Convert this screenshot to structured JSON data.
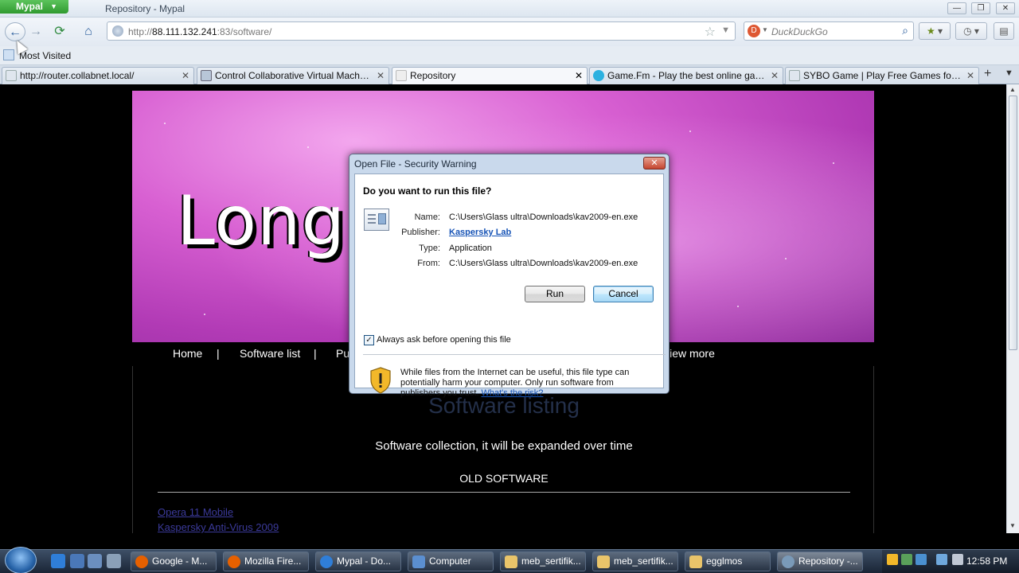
{
  "window": {
    "app_button": "Mypal",
    "title": "Repository - Mypal",
    "minimize_glyph": "—",
    "restore_glyph": "❐",
    "close_glyph": "✕"
  },
  "nav": {
    "back_icon": "arrow-left",
    "forward_icon": "arrow-right",
    "reload_icon": "reload",
    "home_icon": "home",
    "url_prefix": "http://",
    "url_host": "88.111.132.241",
    "url_rest": ":83/software/",
    "search_placeholder": "DuckDuckGo",
    "search_engine_icon": "duckduckgo"
  },
  "bookmarks": {
    "most_visited": "Most Visited"
  },
  "tabs": [
    {
      "label": "http://router.collabnet.local/",
      "active": false
    },
    {
      "label": "Control Collaborative Virtual Machin...",
      "active": false
    },
    {
      "label": "Repository",
      "active": true
    },
    {
      "label": "Game.Fm - Play the best online gam...",
      "active": false
    },
    {
      "label": "SYBO Game | Play Free Games for m...",
      "active": false
    }
  ],
  "tab_new": "+",
  "page": {
    "banner_text": "Longh                  s Repo",
    "menu": {
      "home": "Home",
      "sep1": "|",
      "software_list": "Software list",
      "sep2": "|",
      "partial": "Pu",
      "view_more": "View more"
    },
    "heading": "Software listing",
    "subtitle": "Software collection, it will be expanded over time",
    "section": "OLD SOFTWARE",
    "links": [
      "Opera 11 Mobile",
      "Kaspersky Anti-Virus 2009"
    ]
  },
  "dialog": {
    "title": "Open File - Security Warning",
    "question": "Do you want to run this file?",
    "labels": {
      "name": "Name:",
      "publisher": "Publisher:",
      "type": "Type:",
      "from": "From:"
    },
    "values": {
      "name": "C:\\Users\\Glass ultra\\Downloads\\kav2009-en.exe",
      "publisher": "Kaspersky Lab",
      "type": "Application",
      "from": "C:\\Users\\Glass ultra\\Downloads\\kav2009-en.exe"
    },
    "run_button": "Run",
    "cancel_button": "Cancel",
    "checkbox_label": "Always ask before opening this file",
    "checkbox_checked": true,
    "warning_text": "While files from the Internet can be useful, this file type can potentially harm your computer. Only run software from publishers you trust.",
    "risk_link": "What's the risk?"
  },
  "taskbar": {
    "items": [
      {
        "label": "Google - M...",
        "icon": "firefox-icon",
        "color": "#e66000"
      },
      {
        "label": "Mozilla Fire...",
        "icon": "firefox-icon",
        "color": "#e66000"
      },
      {
        "label": "Mypal - Do...",
        "icon": "ie-icon",
        "color": "#2f7ed8"
      },
      {
        "label": "Computer",
        "icon": "computer-icon",
        "color": "#5b8fd0"
      },
      {
        "label": "meb_sertifik...",
        "icon": "folder-icon",
        "color": "#e9c46a"
      },
      {
        "label": "meb_sertifik...",
        "icon": "folder-icon",
        "color": "#e9c46a"
      },
      {
        "label": "egglmos",
        "icon": "folder-icon",
        "color": "#e9c46a"
      },
      {
        "label": "Repository -...",
        "icon": "mypal-icon",
        "color": "#7a9ab8",
        "active": true
      }
    ],
    "clock": "12:58 PM"
  }
}
